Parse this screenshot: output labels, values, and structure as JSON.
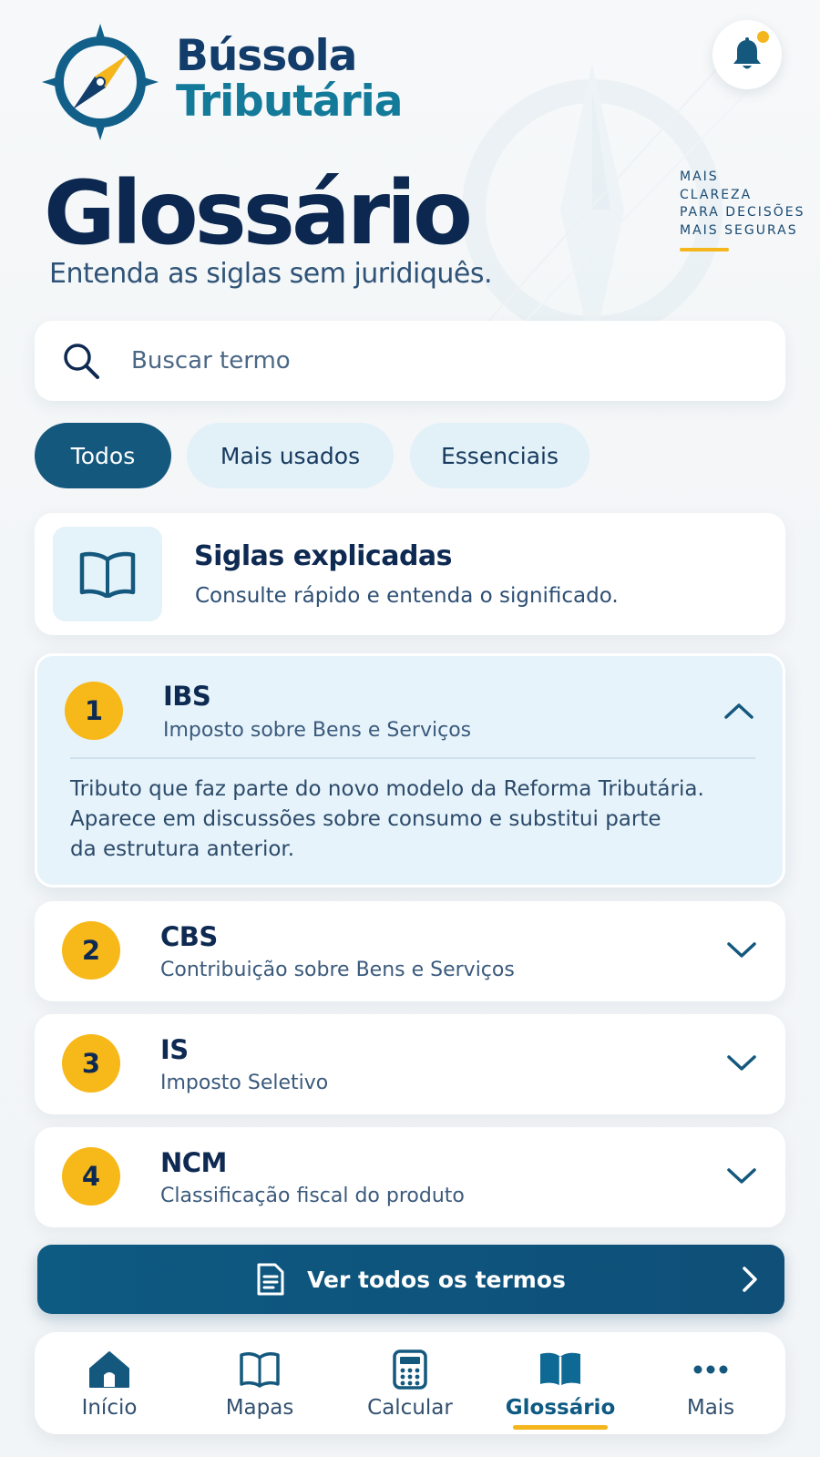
{
  "brand": {
    "line1": "Bússola",
    "line2": "Tributária"
  },
  "notifications": {
    "icon": "bell-icon",
    "has_unread": true
  },
  "tagline": [
    "MAIS",
    "CLAREZA",
    "PARA DECISÕES",
    "MAIS SEGURAS"
  ],
  "page": {
    "title": "Glossário",
    "subtitle": "Entenda as siglas sem juridiquês."
  },
  "search": {
    "placeholder": "Buscar termo",
    "value": "",
    "icon": "search-icon"
  },
  "filters": [
    {
      "label": "Todos",
      "active": true
    },
    {
      "label": "Mais usados",
      "active": false
    },
    {
      "label": "Essenciais",
      "active": false
    }
  ],
  "info_card": {
    "icon": "book-icon",
    "title": "Siglas explicadas",
    "description": "Consulte rápido e entenda o significado."
  },
  "terms": [
    {
      "number": "1",
      "acronym": "IBS",
      "full_name": "Imposto sobre Bens e Serviços",
      "expanded": true,
      "description": [
        "Tributo que faz parte do novo modelo da Reforma Tributária.",
        "Aparece em discussões sobre consumo e substitui parte",
        "da estrutura anterior."
      ]
    },
    {
      "number": "2",
      "acronym": "CBS",
      "full_name": "Contribuição sobre Bens e Serviços",
      "expanded": false
    },
    {
      "number": "3",
      "acronym": "IS",
      "full_name": "Imposto Seletivo",
      "expanded": false
    },
    {
      "number": "4",
      "acronym": "NCM",
      "full_name": "Classificação fiscal do produto",
      "expanded": false
    }
  ],
  "cta": {
    "label": "Ver todos os termos",
    "icon": "document-icon"
  },
  "nav": [
    {
      "label": "Início",
      "icon": "home-icon",
      "active": false
    },
    {
      "label": "Mapas",
      "icon": "map-book-icon",
      "active": false
    },
    {
      "label": "Calcular",
      "icon": "calculator-icon",
      "active": false
    },
    {
      "label": "Glossário",
      "icon": "glossary-book-icon",
      "active": true
    },
    {
      "label": "Mais",
      "icon": "more-icon",
      "active": false
    }
  ],
  "colors": {
    "primary": "#14587e",
    "accent": "#f7b81a",
    "title": "#0c2850",
    "chip_bg": "#e2f0f8",
    "expanded_bg": "#e6f3fa"
  }
}
